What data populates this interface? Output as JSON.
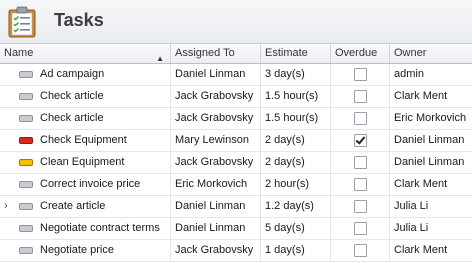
{
  "header": {
    "title": "Tasks",
    "icon": "clipboard-checklist-icon"
  },
  "columns": [
    {
      "key": "name",
      "label": "Name",
      "sorted": "ascending"
    },
    {
      "key": "assigned",
      "label": "Assigned To"
    },
    {
      "key": "estimate",
      "label": "Estimate"
    },
    {
      "key": "overdue",
      "label": "Overdue"
    },
    {
      "key": "owner",
      "label": "Owner"
    }
  ],
  "rows": [
    {
      "name": "Ad campaign",
      "assigned": "Daniel Linman",
      "estimate": "3 day(s)",
      "overdue": false,
      "owner": "admin",
      "priority": "normal",
      "priority_color": "#c8ccd2"
    },
    {
      "name": "Check article",
      "assigned": "Jack Grabovsky",
      "estimate": "1.5 hour(s)",
      "overdue": false,
      "owner": "Clark Ment",
      "priority": "normal",
      "priority_color": "#c8ccd2"
    },
    {
      "name": "Check article",
      "assigned": "Jack Grabovsky",
      "estimate": "1.5 hour(s)",
      "overdue": false,
      "owner": "Eric Morkovich",
      "priority": "normal",
      "priority_color": "#c8ccd2"
    },
    {
      "name": "Check Equipment",
      "assigned": "Mary Lewinson",
      "estimate": "2 day(s)",
      "overdue": true,
      "owner": "Daniel Linman",
      "priority": "high",
      "priority_color": "#e0261b"
    },
    {
      "name": "Clean Equipment",
      "assigned": "Jack Grabovsky",
      "estimate": "2 day(s)",
      "overdue": false,
      "owner": "Daniel Linman",
      "priority": "medium",
      "priority_color": "#f2c200"
    },
    {
      "name": "Correct invoice price",
      "assigned": "Eric Morkovich",
      "estimate": "2 hour(s)",
      "overdue": false,
      "owner": "Clark Ment",
      "priority": "normal",
      "priority_color": "#c8ccd2"
    },
    {
      "name": "Create article",
      "assigned": "Daniel Linman",
      "estimate": "1.2 day(s)",
      "overdue": false,
      "owner": "Julia Li",
      "priority": "normal",
      "priority_color": "#c8ccd2",
      "focused": true
    },
    {
      "name": "Negotiate contract terms",
      "assigned": "Daniel Linman",
      "estimate": "5 day(s)",
      "overdue": false,
      "owner": "Julia Li",
      "priority": "normal",
      "priority_color": "#c8ccd2"
    },
    {
      "name": "Negotiate price",
      "assigned": "Jack Grabovsky",
      "estimate": "1 day(s)",
      "overdue": false,
      "owner": "Clark Ment",
      "priority": "normal",
      "priority_color": "#c8ccd2"
    }
  ],
  "colors": {
    "header_bg": "#e9ecf0",
    "grid_line": "#e3e6ea",
    "high_priority": "#e0261b",
    "medium_priority": "#f2c200"
  }
}
